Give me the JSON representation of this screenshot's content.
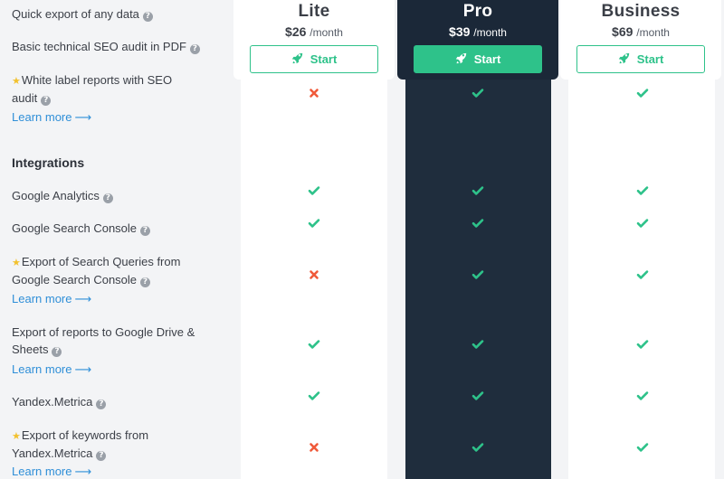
{
  "colors": {
    "accent": "#2ec28a",
    "pro_bg": "#1f2d3d",
    "cross": "#f05a3a",
    "link": "#2f8fd8"
  },
  "plans": [
    {
      "name": "Lite",
      "price": "$26",
      "period": "/month",
      "button": "Start"
    },
    {
      "name": "Pro",
      "price": "$39",
      "period": "/month",
      "button": "Start"
    },
    {
      "name": "Business",
      "price": "$69",
      "period": "/month",
      "button": "Start"
    }
  ],
  "features": {
    "quick_export": "Quick export of any data",
    "seo_audit": "Basic technical SEO audit in PDF",
    "white_label": "White label reports with SEO audit",
    "learn_more": "Learn more",
    "integrations_heading": "Integrations",
    "google_analytics": "Google Analytics",
    "google_search_console": "Google Search Console",
    "export_queries": "Export of Search Queries from Google Search Console",
    "export_drive": "Export of reports to Google Drive & Sheets",
    "yandex_metrica": "Yandex.Metrica",
    "export_yandex": "Export of keywords from Yandex.Metrica"
  },
  "availability": {
    "white_label": [
      false,
      true,
      true
    ],
    "google_analytics": [
      true,
      true,
      true
    ],
    "google_search_console": [
      true,
      true,
      true
    ],
    "export_queries": [
      false,
      true,
      true
    ],
    "export_drive": [
      true,
      true,
      true
    ],
    "yandex_metrica": [
      true,
      true,
      true
    ],
    "export_yandex": [
      false,
      true,
      true
    ]
  },
  "icons": {
    "help": "question-circle-icon",
    "premium": "star-icon",
    "start": "rocket-icon",
    "included": "check-icon",
    "excluded": "cross-icon",
    "learn_arrow": "arrow-right-icon"
  }
}
